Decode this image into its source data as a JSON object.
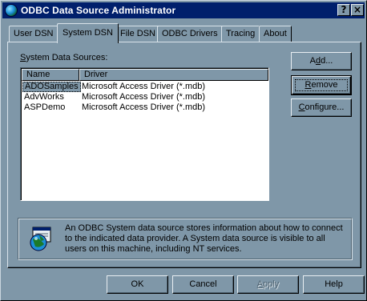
{
  "window": {
    "title": "ODBC Data Source Administrator",
    "help_button": "?",
    "close_button": "×"
  },
  "tabs": [
    {
      "label": "User DSN",
      "active": false
    },
    {
      "label": "System DSN",
      "active": true
    },
    {
      "label": "File DSN",
      "active": false
    },
    {
      "label": "ODBC Drivers",
      "active": false
    },
    {
      "label": "Tracing",
      "active": false
    },
    {
      "label": "About",
      "active": false
    }
  ],
  "panel": {
    "list_label_prefix": "",
    "list_label_accel": "S",
    "list_label_rest": "ystem Data Sources:",
    "columns": [
      "Name",
      "Driver"
    ],
    "rows": [
      {
        "name": "ADOSamples",
        "driver": "Microsoft Access Driver (*.mdb)",
        "selected": true
      },
      {
        "name": "AdvWorks",
        "driver": "Microsoft Access Driver (*.mdb)",
        "selected": false
      },
      {
        "name": "ASPDemo",
        "driver": "Microsoft Access Driver (*.mdb)",
        "selected": false
      }
    ],
    "buttons": {
      "add": {
        "pre": "A",
        "accel": "d",
        "post": "d..."
      },
      "remove": {
        "pre": "",
        "accel": "R",
        "post": "emove"
      },
      "configure": {
        "pre": "",
        "accel": "C",
        "post": "onfigure..."
      }
    },
    "info": {
      "icon": "odbc-globe-icon",
      "text": "An ODBC System data source stores information about how to connect to the indicated data provider.  A System data source is visible to all users on this machine, including NT services."
    }
  },
  "footer": {
    "ok": "OK",
    "cancel": "Cancel",
    "apply": {
      "pre": "",
      "accel": "A",
      "post": "pply",
      "disabled": true
    },
    "help": "Help"
  },
  "colors": {
    "face": "#7f97a8",
    "titlebar": "#001f6c",
    "highlight": "#d9e3ea",
    "shadow": "#4e6270"
  }
}
